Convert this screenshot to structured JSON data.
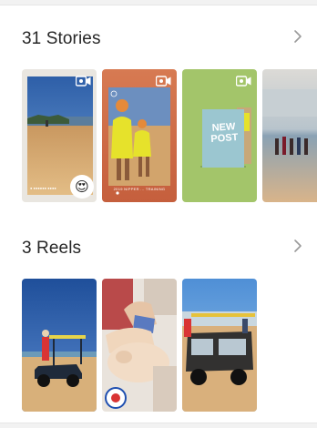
{
  "stories": {
    "title": "31 Stories",
    "items": [
      {
        "kind": "beach",
        "video": true,
        "reaction": "😍"
      },
      {
        "kind": "lifeguards",
        "video": true,
        "caption": "2019 NIPPER ... TRAINING"
      },
      {
        "kind": "new-post",
        "video": true,
        "overlay_text": "NEW POST"
      },
      {
        "kind": "shore-people",
        "video": false
      }
    ]
  },
  "reels": {
    "title": "3 Reels",
    "items": [
      {
        "kind": "rescue-vehicle"
      },
      {
        "kind": "cpr-training"
      },
      {
        "kind": "buggy-at-beach"
      }
    ]
  },
  "colors": {
    "title": "#262626",
    "chevron": "#9a9a9a",
    "divider": "#f2f2f2",
    "sky_blue": "#4a78b8",
    "sand": "#d8b07a",
    "olive_green": "#a3c56a"
  },
  "icons": [
    "chevron-right-icon",
    "video-camera-icon"
  ]
}
